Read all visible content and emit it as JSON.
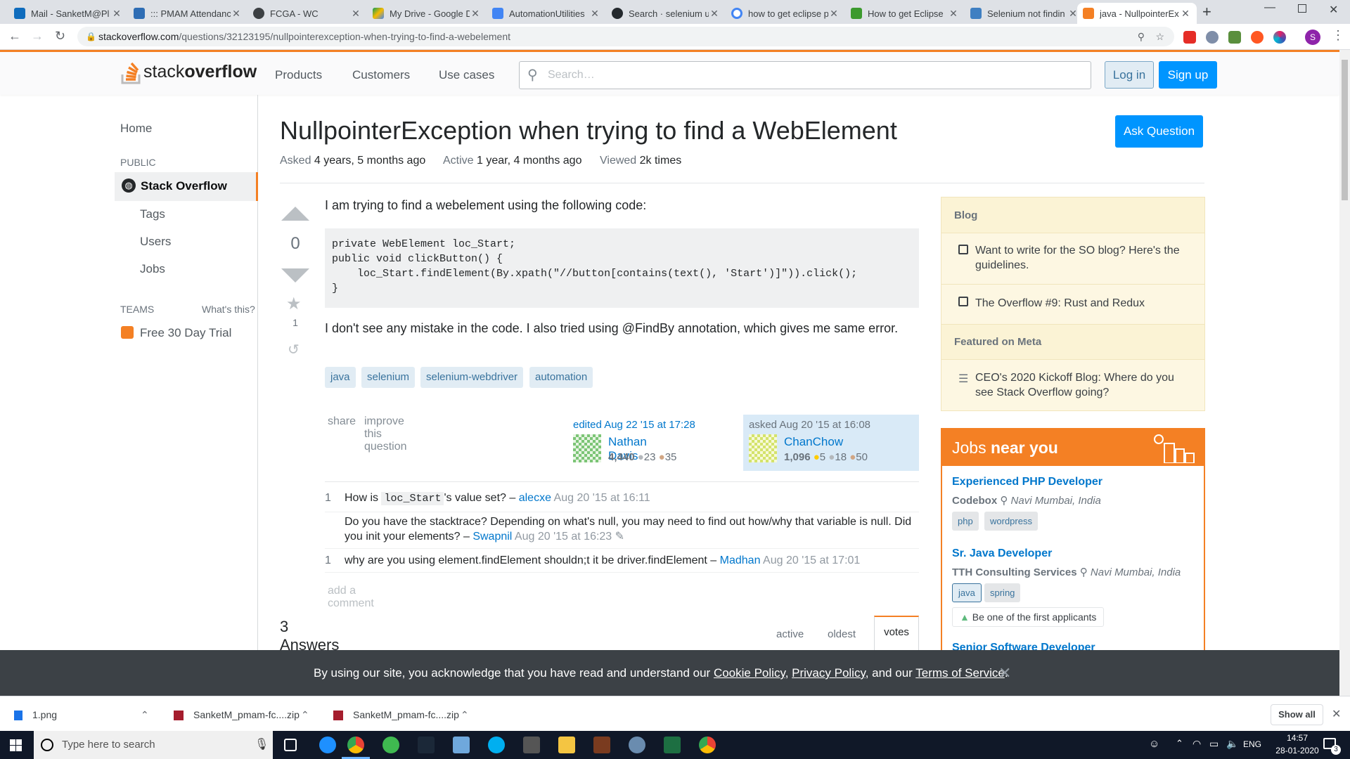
{
  "browser": {
    "tabs": [
      {
        "title": "Mail - SanketM@Pl",
        "color": "#0f6cbd"
      },
      {
        "title": "::: PMAM Attendanc",
        "color": "#2e6db4"
      },
      {
        "title": "FCGA - WC",
        "color": "#3c4043"
      },
      {
        "title": "My Drive - Google D",
        "color": "#f6b900"
      },
      {
        "title": "AutomationUtilities",
        "color": "#4285f4"
      },
      {
        "title": "Search · selenium u",
        "color": "#24292e"
      },
      {
        "title": "how to get eclipse p",
        "color": "#4285f4"
      },
      {
        "title": "How to get Eclipse",
        "color": "#3c9a2e"
      },
      {
        "title": "Selenium not findin",
        "color": "#3f7fc2"
      },
      {
        "title": "java - NullpointerEx",
        "color": "#f48024"
      }
    ],
    "url_host": "stackoverflow.com",
    "url_path": "/questions/32123195/nullpointerexception-when-trying-to-find-a-webelement",
    "profile_initial": "S"
  },
  "header": {
    "logo_plain": "stack",
    "logo_bold": "overflow",
    "nav": [
      "Products",
      "Customers",
      "Use cases"
    ],
    "search_placeholder": "Search…",
    "login": "Log in",
    "signup": "Sign up"
  },
  "leftnav": {
    "home": "Home",
    "public": "PUBLIC",
    "so": "Stack Overflow",
    "tags": "Tags",
    "users": "Users",
    "jobs": "Jobs",
    "teams": "TEAMS",
    "whats": "What's this?",
    "trial": "Free 30 Day Trial"
  },
  "question": {
    "title": "NullpointerException when trying to find a WebElement",
    "ask_button": "Ask Question",
    "asked_label": "Asked",
    "asked_value": "4 years, 5 months ago",
    "active_label": "Active",
    "active_value": "1 year, 4 months ago",
    "viewed_label": "Viewed",
    "viewed_value": "2k times",
    "votes": "0",
    "favorites": "1",
    "body1": "I am trying to find a webelement using the following code:",
    "code": [
      "private WebElement loc_Start;",
      "public void clickButton() {",
      "    loc_Start.findElement(By.xpath(\"//button[contains(text(), 'Start')]\")).click();",
      "}"
    ],
    "body2": "I don't see any mistake in the code. I also tried using @FindBy annotation, which gives me same error.",
    "tags": [
      "java",
      "selenium",
      "selenium-webdriver",
      "automation"
    ],
    "share": "share",
    "improve": "improve this question",
    "edited_label": "edited Aug 22 '15 at 17:28",
    "editor_name": "Nathan Davis",
    "editor_rep": "4,440",
    "editor_silver": "23",
    "editor_bronze": "35",
    "asked_by_label": "asked Aug 20 '15 at 16:08",
    "asker_name": "ChanChow",
    "asker_rep": "1,096",
    "asker_gold": "5",
    "asker_silver": "18",
    "asker_bronze": "50"
  },
  "comments": [
    {
      "score": "1",
      "pre": "How is",
      "code": "loc_Start",
      "post": "'s value set? –",
      "user": "alecxe",
      "date": "Aug 20 '15 at 16:11"
    },
    {
      "score": "",
      "text": "Do you have the stacktrace? Depending on what's null, you may need to find out how/why that variable is null. Did you init your elements? –",
      "user": "Swapnil",
      "date": "Aug 20 '15 at 16:23"
    },
    {
      "score": "1",
      "text": "why are you using element.findElement shouldn;t it be driver.findElement –",
      "user": "Madhan",
      "date": "Aug 20 '15 at 17:01"
    }
  ],
  "add_comment": "add a comment",
  "answers": {
    "count_label": "3 Answers",
    "sort": [
      "active",
      "oldest",
      "votes"
    ]
  },
  "sidebar": {
    "blog_header": "Blog",
    "blog_items": [
      "Want to write for the SO blog? Here's the guidelines.",
      "The Overflow #9: Rust and Redux"
    ],
    "meta_header": "Featured on Meta",
    "meta_items": [
      "CEO's 2020 Kickoff Blog: Where do you see Stack Overflow going?"
    ],
    "jobs_title_plain": "Jobs",
    "jobs_title_bold": "near you",
    "jobs": [
      {
        "title": "Experienced PHP Developer",
        "company": "Codebox",
        "location": "Navi Mumbai, India",
        "tags": [
          "php",
          "wordpress"
        ]
      },
      {
        "title": "Sr. Java Developer",
        "company": "TTH Consulting Services",
        "location": "Navi Mumbai, India",
        "tags": [
          "java",
          "spring"
        ],
        "note": "Be one of the first applicants"
      },
      {
        "title": "Senior Software Developer"
      }
    ]
  },
  "cookie": {
    "text_pre": "By using our site, you acknowledge that you have read and understand our",
    "cookie_policy": "Cookie Policy",
    "comma": ",",
    "privacy_policy": "Privacy Policy",
    "and": ", and our",
    "terms": "Terms of Service",
    "period": "."
  },
  "downloads": {
    "items": [
      "1.png",
      "SanketM_pmam-fc....zip",
      "SanketM_pmam-fc....zip"
    ],
    "show_all": "Show all"
  },
  "taskbar": {
    "search_placeholder": "Type here to search",
    "lang": "ENG",
    "time": "14:57",
    "date": "28-01-2020",
    "notif_count": "3"
  }
}
